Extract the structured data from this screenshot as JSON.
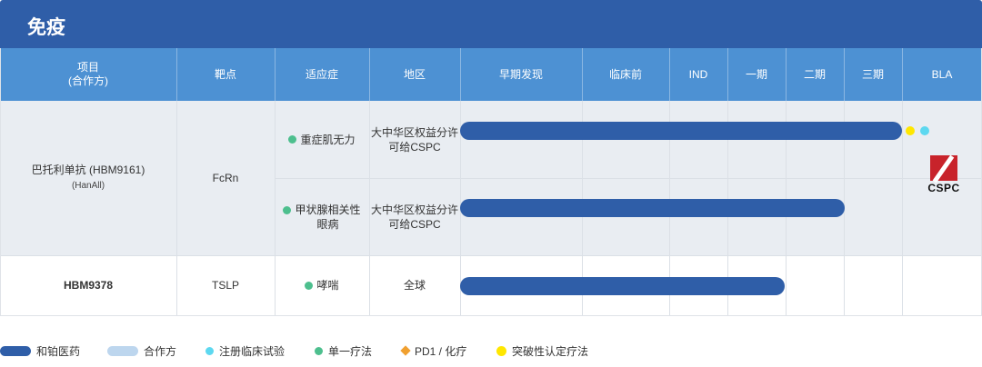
{
  "section": {
    "title": "免疫"
  },
  "columns": [
    "项目",
    "靶点",
    "适应症",
    "地区",
    "早期发现",
    "临床前",
    "IND",
    "一期",
    "二期",
    "三期",
    "BLA"
  ],
  "columns_project_sub": "(合作方)",
  "rows": [
    {
      "project": "巴托利单抗 (HBM9161)",
      "partner": "(HanAll)",
      "target": "FcRn",
      "indications": [
        {
          "name": "重症肌无力",
          "region": [
            "大中华区权益分许",
            "可给CSPC"
          ],
          "progress_to": "BLA",
          "markers": [
            "yellow",
            "cyan"
          ]
        },
        {
          "name": "甲状腺相关性眼病",
          "name_lines": [
            "甲状腺相关性",
            "眼病"
          ],
          "region": [
            "大中华区权益分许",
            "可给CSPC"
          ],
          "progress_to": "三期"
        }
      ],
      "licensee_logo": "CSPC"
    },
    {
      "project": "HBM9378",
      "target": "TSLP",
      "indications": [
        {
          "name": "哮喘",
          "region": [
            "全球"
          ],
          "progress_to": "二期"
        }
      ]
    }
  ],
  "legend": [
    {
      "icon": "dark-bar",
      "label": "和铂医药"
    },
    {
      "icon": "light-bar",
      "label": "合作方"
    },
    {
      "icon": "cyan-dot",
      "label": "注册临床试验"
    },
    {
      "icon": "green-dot",
      "label": "单一疗法"
    },
    {
      "icon": "orange-diamond",
      "label": "PD1 / 化疗"
    },
    {
      "icon": "yellow-dot",
      "label": "突破性认定疗法"
    }
  ],
  "colors": {
    "header": "#2f5ea8",
    "table_header": "#4d91d3",
    "bar": "#2f5ea8",
    "partner_bar": "#bdd6ee",
    "green": "#4dbf8e",
    "yellow": "#ffe700",
    "cyan": "#5dd8f0",
    "orange": "#f0a030"
  }
}
